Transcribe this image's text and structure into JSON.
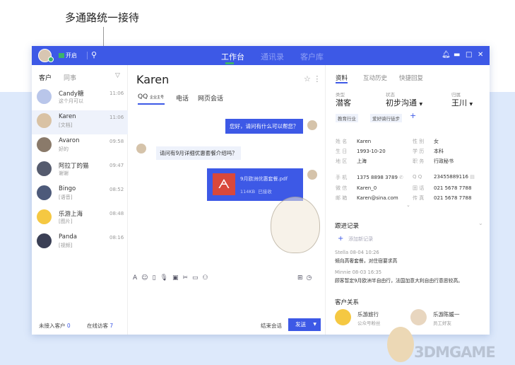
{
  "annotation": "多通路统一接待",
  "topbar": {
    "status": "开启",
    "tabs": [
      "工作台",
      "通讯录",
      "客户库"
    ]
  },
  "left": {
    "tabs": [
      "客户",
      "同事"
    ],
    "contacts": [
      {
        "name": "Candy糖",
        "preview": "这个月可以",
        "time": "11:06"
      },
      {
        "name": "Karen",
        "preview": "[文档]",
        "time": "11:06"
      },
      {
        "name": "Avaron",
        "preview": "好的",
        "time": "09:58"
      },
      {
        "name": "阿拉丁的猫",
        "preview": "谢谢",
        "time": "09:47"
      },
      {
        "name": "Bingo",
        "preview": "[语音]",
        "time": "08:52"
      },
      {
        "name": "乐游上海",
        "preview": "[图片]",
        "time": "08:48"
      },
      {
        "name": "Panda",
        "preview": "[视频]",
        "time": "08:16"
      }
    ],
    "footer": {
      "pending_label": "未接入客户",
      "pending_count": "0",
      "online_label": "在线访客",
      "online_count": "7"
    }
  },
  "chat": {
    "name": "Karen",
    "tabs": [
      {
        "label": "QQ",
        "sub": "企业主号"
      },
      {
        "label": "电话"
      },
      {
        "label": "网页会话"
      }
    ],
    "messages": {
      "m1": "您好，请问有什么可以帮您？",
      "m2": "请问有9月详细优惠套餐介绍吗？"
    },
    "file": {
      "name": "9月欧洲优惠套餐.pdf",
      "size": "114KB",
      "status": "已接收"
    },
    "end_label": "结束会话",
    "send_label": "发送"
  },
  "right": {
    "tabs": [
      "资料",
      "互动历史",
      "快捷回复"
    ],
    "type_label": "类型",
    "type": "潜客",
    "state_label": "状态",
    "state": "初步沟通",
    "owner_label": "归属",
    "owner": "王川",
    "tags": [
      "教育行业",
      "爱好骑行徒步"
    ],
    "fields": [
      {
        "k": "姓 名",
        "v": "Karen"
      },
      {
        "k": "性 别",
        "v": "女"
      },
      {
        "k": "生 日",
        "v": "1993-10-20"
      },
      {
        "k": "学 历",
        "v": "本科"
      },
      {
        "k": "地 区",
        "v": "上海"
      },
      {
        "k": "职 务",
        "v": "行政秘书"
      },
      {
        "k": "手 机",
        "v": "1375 8898 3789"
      },
      {
        "k": "Q Q",
        "v": "23455889116"
      },
      {
        "k": "微 信",
        "v": "Karen_0"
      },
      {
        "k": "固 话",
        "v": "021 5678 7788"
      },
      {
        "k": "邮 箱",
        "v": "Karen@sina.com"
      },
      {
        "k": "传 真",
        "v": "021 5678 7788"
      }
    ],
    "followup_title": "跟进记录",
    "add_record": "添加新记录",
    "notes": [
      {
        "meta": "Stella  08-04  10:26",
        "text": "倾向高奢套餐，对住宿要求高"
      },
      {
        "meta": "Minnie  08-03  16:35",
        "text": "顾客暂定9月欧洲半自由行，法国加意大利自由行意愿较高。"
      }
    ],
    "relations_title": "客户关系",
    "relations": [
      {
        "name": "乐游旅行",
        "sub": "公众号粉丝"
      },
      {
        "name": "乐游陈媛一",
        "sub": "员工好友"
      }
    ]
  },
  "watermark": "3DMGAME"
}
